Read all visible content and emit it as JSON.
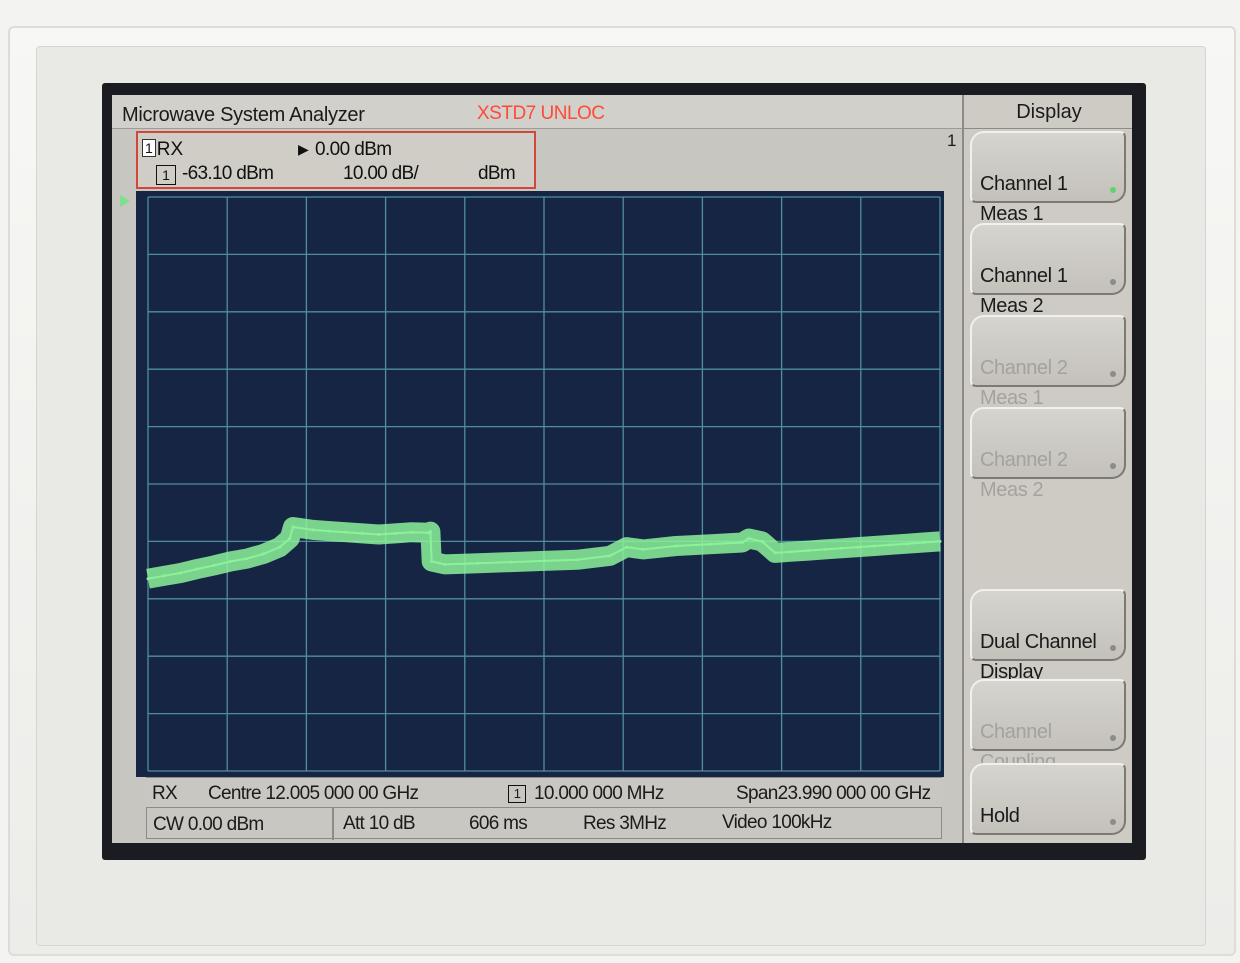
{
  "title_bar": {
    "app_title": "Microwave System Analyzer",
    "status_alert": "XSTD7 UNLOC"
  },
  "readout": {
    "channel_tag": "1",
    "channel_name": "RX",
    "reference_level": "0.00 dBm",
    "marker_number": "1",
    "marker_value": "-63.10 dBm",
    "scale": "10.00 dB/",
    "unit": "dBm"
  },
  "marker_indicator": "1",
  "bottom_bar": {
    "channel": "RX",
    "centre": "Centre 12.005 000 00 GHz",
    "marker_box": "1",
    "marker_freq": "10.000 000 MHz",
    "span": "Span23.990 000 00 GHz",
    "cw": "CW 0.00 dBm",
    "attenuation": "Att 10 dB",
    "sweep_time": "606 ms",
    "resolution_bw": "Res 3MHz",
    "video_bw": "Video 100kHz"
  },
  "softkeys": {
    "panel_title": "Display",
    "items": [
      {
        "label": "Channel 1\nMeas 1",
        "enabled": true,
        "active": true
      },
      {
        "label": "Channel 1\nMeas 2",
        "enabled": true,
        "active": false
      },
      {
        "label": "Channel 2\nMeas 1",
        "enabled": false,
        "active": false
      },
      {
        "label": "Channel 2\nMeas 2",
        "enabled": false,
        "active": false
      },
      {
        "label": "Dual Channel\nDisplay",
        "enabled": true,
        "active": false
      },
      {
        "label": "Channel\nCoupling",
        "enabled": false,
        "active": false
      },
      {
        "label": "Hold",
        "enabled": true,
        "active": false
      }
    ]
  },
  "colors": {
    "trace": "#8cf29a",
    "plot_background": "#172545",
    "grid": "#4f8f9a",
    "alert": "#ff4a3a"
  },
  "chart_data": {
    "type": "line",
    "title": "",
    "xlabel": "",
    "ylabel": "",
    "x_range_ghz": [
      0.01,
      23.99
    ],
    "ylim": [
      -100,
      0
    ],
    "grid": true,
    "divisions": {
      "x": 10,
      "y": 10
    },
    "series": [
      {
        "x": [
          0.01,
          0.5,
          1.0,
          1.5,
          2.0,
          2.5,
          3.0,
          3.5,
          4.0,
          4.3,
          4.4,
          5.0,
          5.5,
          6.0,
          6.5,
          7.0,
          7.5,
          8.0,
          8.5,
          8.56,
          8.6,
          9.0,
          10.0,
          11.0,
          12.0,
          13.0,
          14.0,
          14.5,
          15.0,
          16.0,
          17.0,
          18.0,
          18.2,
          18.6,
          19.0,
          19.5,
          20.0,
          20.5,
          21.0,
          21.5,
          22.0,
          22.5,
          23.0,
          23.5,
          23.99
        ],
        "y": [
          -66.5,
          -66.0,
          -65.5,
          -64.8,
          -64.2,
          -63.5,
          -63.0,
          -62.2,
          -61.0,
          -59.5,
          -57.5,
          -58.0,
          -58.2,
          -58.4,
          -58.6,
          -58.8,
          -58.6,
          -58.4,
          -58.5,
          -58.3,
          -63.5,
          -64.0,
          -63.8,
          -63.6,
          -63.4,
          -63.2,
          -62.5,
          -61.0,
          -61.4,
          -60.8,
          -60.5,
          -60.2,
          -59.5,
          -60.0,
          -62.0,
          -61.8,
          -61.6,
          -61.4,
          -61.2,
          -61.0,
          -60.8,
          -60.6,
          -60.4,
          -60.2,
          -60.0
        ]
      }
    ]
  }
}
